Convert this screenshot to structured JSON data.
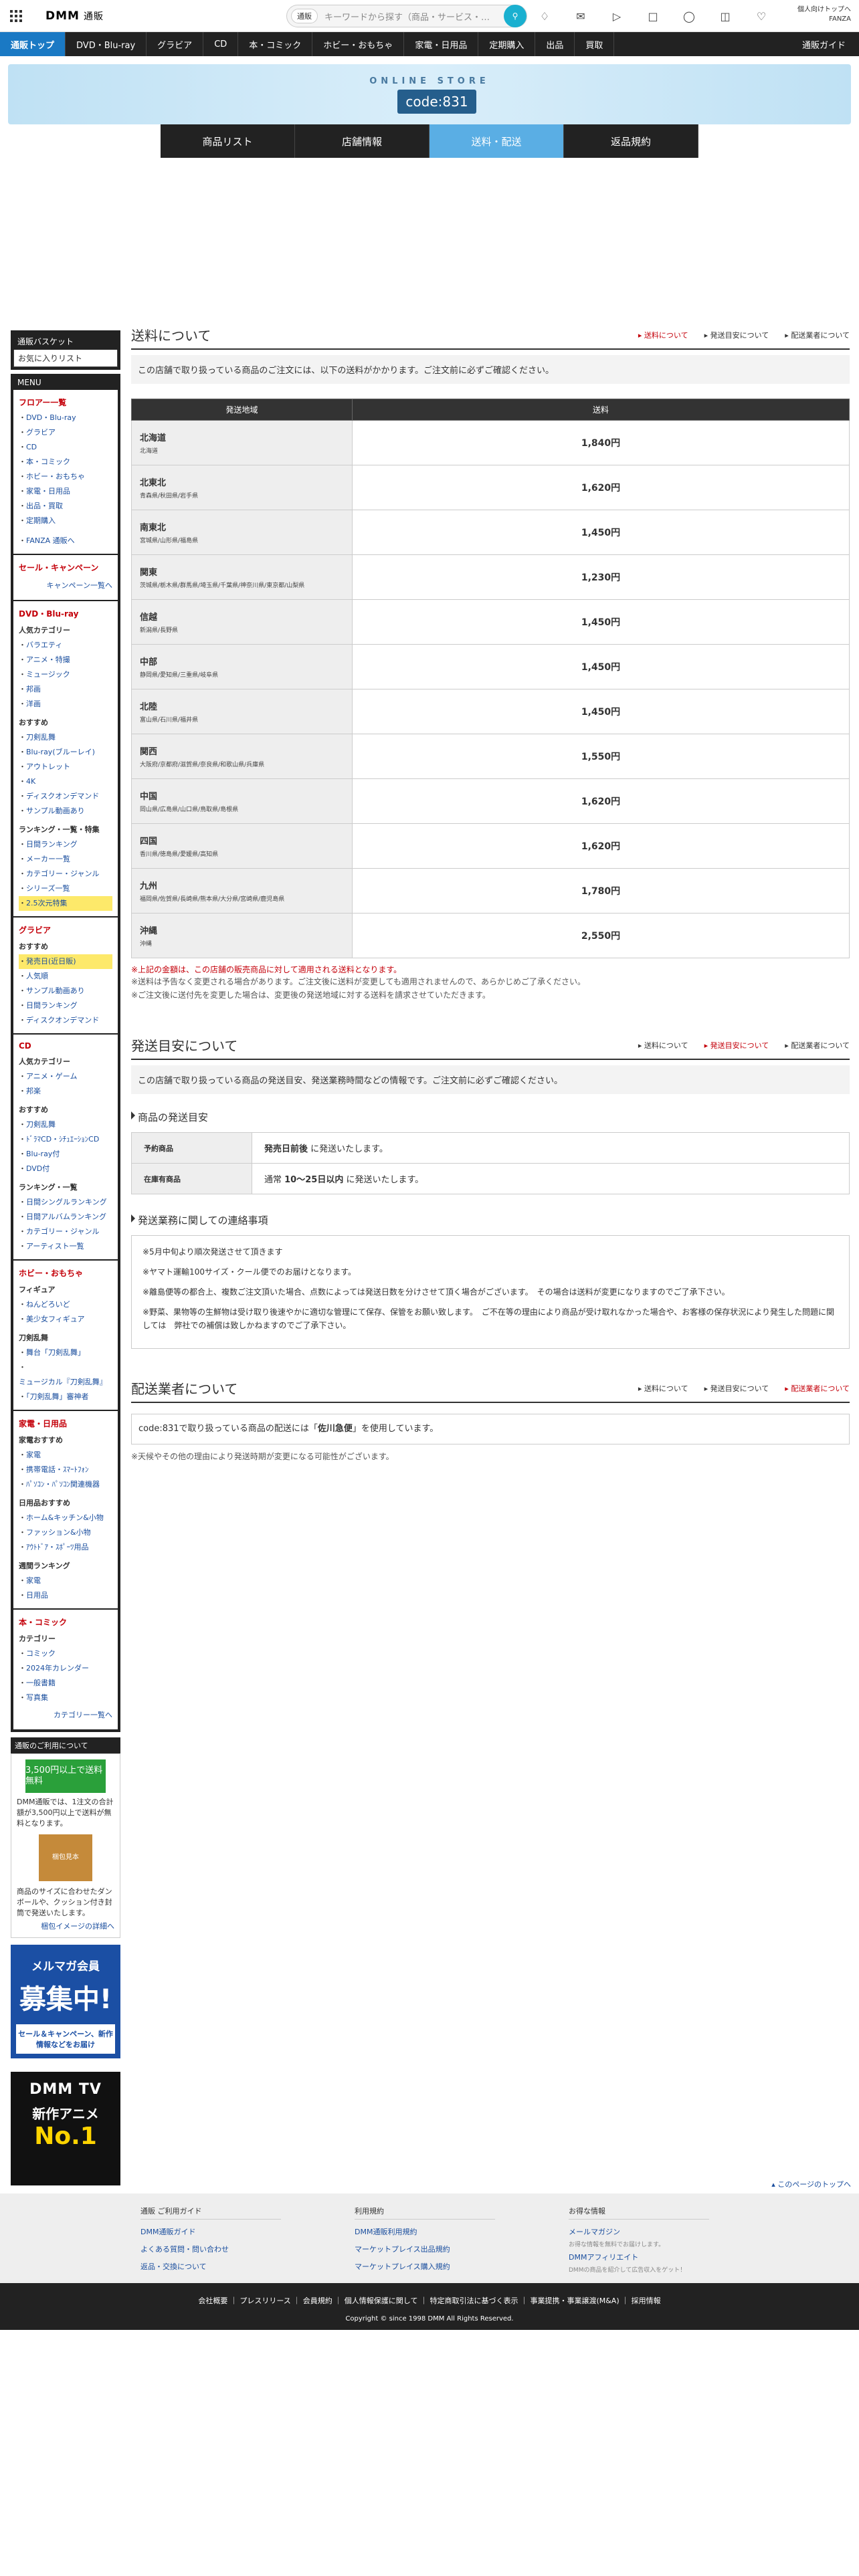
{
  "header": {
    "logo": "DMM",
    "logo_sub": "通販",
    "search_cat": "通販",
    "search_placeholder": "キーワードから探す（商品・サービス・…",
    "account_line1": "個人向けトップへ",
    "account_line2": "FANZA"
  },
  "gnav": {
    "items": [
      "通販トップ",
      "DVD・Blu-ray",
      "グラビア",
      "CD",
      "本・コミック",
      "ホビー・おもちゃ",
      "家電・日用品",
      "定期購入",
      "出品",
      "買取"
    ],
    "guide": "通販ガイド"
  },
  "hero": {
    "title": "ONLINE STORE",
    "code": "code:831"
  },
  "tabs": [
    "商品リスト",
    "店舗情報",
    "送料・配送",
    "返品規約"
  ],
  "side": {
    "basket_title": "通販バスケット",
    "basket_body": "お気に入りリスト",
    "menu_title": "MENU",
    "floor": {
      "title": "フロアー一覧",
      "items": [
        "DVD・Blu-ray",
        "グラビア",
        "CD",
        "本・コミック",
        "ホビー・おもちゃ",
        "家電・日用品",
        "出品・買取",
        "定期購入"
      ],
      "fanza": "FANZA 通販へ"
    },
    "sale": {
      "title": "セール・キャンペーン",
      "more": "キャンペーン一覧へ"
    },
    "dvd": {
      "title": "DVD・Blu-ray",
      "cat_h": "人気カテゴリー",
      "cats": [
        "バラエティ",
        "アニメ・特撮",
        "ミュージック",
        "邦画",
        "洋画"
      ],
      "rec_h": "おすすめ",
      "recs": [
        "刀剣乱舞",
        "Blu-ray(ブルーレイ)",
        "アウトレット",
        "4K",
        "ディスクオンデマンド",
        "サンプル動画あり"
      ],
      "rank_h": "ランキング・一覧・特集",
      "ranks": [
        "日間ランキング",
        "メーカー一覧",
        "カテゴリー・ジャンル",
        "シリーズ一覧",
        "2.5次元特集"
      ]
    },
    "grav": {
      "title": "グラビア",
      "rec_h": "おすすめ",
      "recs": [
        "発売日(近日販)",
        "人気順",
        "サンプル動画あり",
        "日間ランキング",
        "ディスクオンデマンド"
      ]
    },
    "cd": {
      "title": "CD",
      "cat_h": "人気カテゴリー",
      "cats": [
        "アニメ・ゲーム",
        "邦楽"
      ],
      "rec_h": "おすすめ",
      "recs": [
        "刀剣乱舞",
        "ﾄﾞﾗﾏCD・ｼﾁｭｴｰｼｮﾝCD",
        "Blu-ray付",
        "DVD付"
      ],
      "rank_h": "ランキング・一覧",
      "ranks": [
        "日間シングルランキング",
        "日間アルバムランキング",
        "カテゴリー・ジャンル",
        "アーティスト一覧"
      ]
    },
    "hobby": {
      "title": "ホビー・おもちゃ",
      "fig_h": "フィギュア",
      "figs": [
        "ねんどろいど",
        "美少女フィギュア"
      ],
      "sword_h": "刀剣乱舞",
      "swords": [
        "舞台「刀剣乱舞」",
        "ミュージカル『刀剣乱舞』",
        "「刀剣乱舞」審神者"
      ]
    },
    "kaden": {
      "title": "家電・日用品",
      "rec_h": "家電おすすめ",
      "recs": [
        "家電",
        "携帯電話・ｽﾏｰﾄﾌｫﾝ",
        "ﾊﾟｿｺﾝ・ﾊﾟｿｺﾝ関連機器"
      ],
      "day_h": "日用品おすすめ",
      "days": [
        "ホーム&キッチン&小物",
        "ファッション&小物",
        "ｱｳﾄﾄﾞｱ・ｽﾎﾟｰﾂ用品"
      ],
      "rank_h": "週間ランキング",
      "ranks": [
        "家電",
        "日用品"
      ]
    },
    "book": {
      "title": "本・コミック",
      "cat_h": "カテゴリー",
      "cats": [
        "コミック",
        "2024年カレンダー",
        "一般書籍",
        "写真集"
      ],
      "more": "カテゴリー一覧へ"
    },
    "promo": {
      "title": "通販のご利用について",
      "ship": "3,500円以上で送料無料",
      "text1": "DMM通販では、1注文の合計額が3,500円以上で送料が無料となります。",
      "box": "梱包見本",
      "text2": "商品のサイズに合わせたダンボールや、クッション付き封筒で発送いたします。",
      "link": "梱包イメージの詳細へ"
    },
    "mm": {
      "a": "メルマガ会員",
      "b": "募集中!",
      "c": "セール＆キャンペーン、新作情報などをお届け"
    },
    "tv": {
      "a": "DMM TV",
      "b": "新作アニメ",
      "c": "No.1"
    }
  },
  "shipping": {
    "title": "送料について",
    "anchors": [
      "送料について",
      "発送目安について",
      "配送業者について"
    ],
    "note": "この店舗で取り扱っている商品のご注文には、以下の送料がかかります。ご注文前に必ずご確認ください。",
    "col_region": "発送地域",
    "col_fee": "送料",
    "rows": [
      {
        "name": "北海道",
        "sub": "北海道",
        "fee": "1,840円"
      },
      {
        "name": "北東北",
        "sub": "青森県/秋田県/岩手県",
        "fee": "1,620円"
      },
      {
        "name": "南東北",
        "sub": "宮城県/山形県/福島県",
        "fee": "1,450円"
      },
      {
        "name": "関東",
        "sub": "茨城県/栃木県/群馬県/埼玉県/千葉県/神奈川県/東京都/山梨県",
        "fee": "1,230円"
      },
      {
        "name": "信越",
        "sub": "新潟県/長野県",
        "fee": "1,450円"
      },
      {
        "name": "中部",
        "sub": "静岡県/愛知県/三重県/岐阜県",
        "fee": "1,450円"
      },
      {
        "name": "北陸",
        "sub": "富山県/石川県/福井県",
        "fee": "1,450円"
      },
      {
        "name": "関西",
        "sub": "大阪府/京都府/滋賀県/奈良県/和歌山県/兵庫県",
        "fee": "1,550円"
      },
      {
        "name": "中国",
        "sub": "岡山県/広島県/山口県/鳥取県/島根県",
        "fee": "1,620円"
      },
      {
        "name": "四国",
        "sub": "香川県/徳島県/愛媛県/高知県",
        "fee": "1,620円"
      },
      {
        "name": "九州",
        "sub": "福岡県/佐賀県/長崎県/熊本県/大分県/宮崎県/鹿児島県",
        "fee": "1,780円"
      },
      {
        "name": "沖縄",
        "sub": "沖縄",
        "fee": "2,550円"
      }
    ],
    "red_note": "※上記の金額は、この店舗の販売商品に対して適用される送料となります。",
    "g1": "※送料は予告なく変更される場合があります。ご注文後に送料が変更しても適用されませんので、あらかじめご了承ください。",
    "g2": "※ご注文後に送付先を変更した場合は、変更後の発送地域に対する送料を請求させていただきます。"
  },
  "estimate": {
    "title": "発送目安について",
    "note": "この店舗で取り扱っている商品の発送目安、発送業務時間などの情報です。ご注文前に必ずご確認ください。",
    "sub1": "商品の発送目安",
    "r1h": "予約商品",
    "r1b": "発売日前後",
    "r1t": " に発送いたします。",
    "r2h": "在庫有商品",
    "r2a": "通常 ",
    "r2b": "10〜25日以内",
    "r2t": " に発送いたします。",
    "sub2": "発送業務に関しての連絡事項",
    "p1": "※5月中旬より順次発送させて頂きます",
    "p2": "※ヤマト運輸100サイズ・クール便でのお届けとなります。",
    "p3": "※離島便等の都合上、複数ご注文頂いた場合、点数によっては発送日数を分けさせて頂く場合がございます。　その場合は送料が変更になりますのでご了承下さい。",
    "p4": "※野菜、果物等の生鮮物は受け取り後速やかに適切な管理にて保存、保管をお願い致します。　ご不在等の理由により商品が受け取れなかった場合や、お客様の保存状況により発生した問題に関しては　弊社での補償は致しかねますのでご了承下さい。"
  },
  "carrier": {
    "title": "配送業者について",
    "pre": "code:831で取り扱っている商品の配送には「",
    "name": "佐川急便",
    "post": "」を使用しています。",
    "g": "※天候やその他の理由により発送時期が変更になる可能性がございます。"
  },
  "footer": {
    "pagetop": "このページのトップへ",
    "c1h": "通販 ご利用ガイド",
    "c1": [
      "DMM通販ガイド",
      "よくある質問・問い合わせ",
      "返品・交換について"
    ],
    "c2h": "利用規約",
    "c2": [
      "DMM通販利用規約",
      "マーケットプレイス出品規約",
      "マーケットプレイス購入規約"
    ],
    "c3h": "お得な情報",
    "c3a": "メールマガジン",
    "c3as": "お得な情報を無料でお届けします。",
    "c3b": "DMMアフィリエイト",
    "c3bs": "DMMの商品を紹介して広告収入をゲット！",
    "links": "会社概要 ｜ プレスリリース ｜ 会員規約 ｜ 個人情報保護に関して ｜ 特定商取引法に基づく表示 ｜ 事業提携・事業譲渡(M&A) ｜ 採用情報",
    "copy": "Copyright © since 1998 DMM All Rights Reserved."
  },
  "colors": {
    "accent": "#1a79c4",
    "red": "#c4000a",
    "dark": "#222222"
  }
}
